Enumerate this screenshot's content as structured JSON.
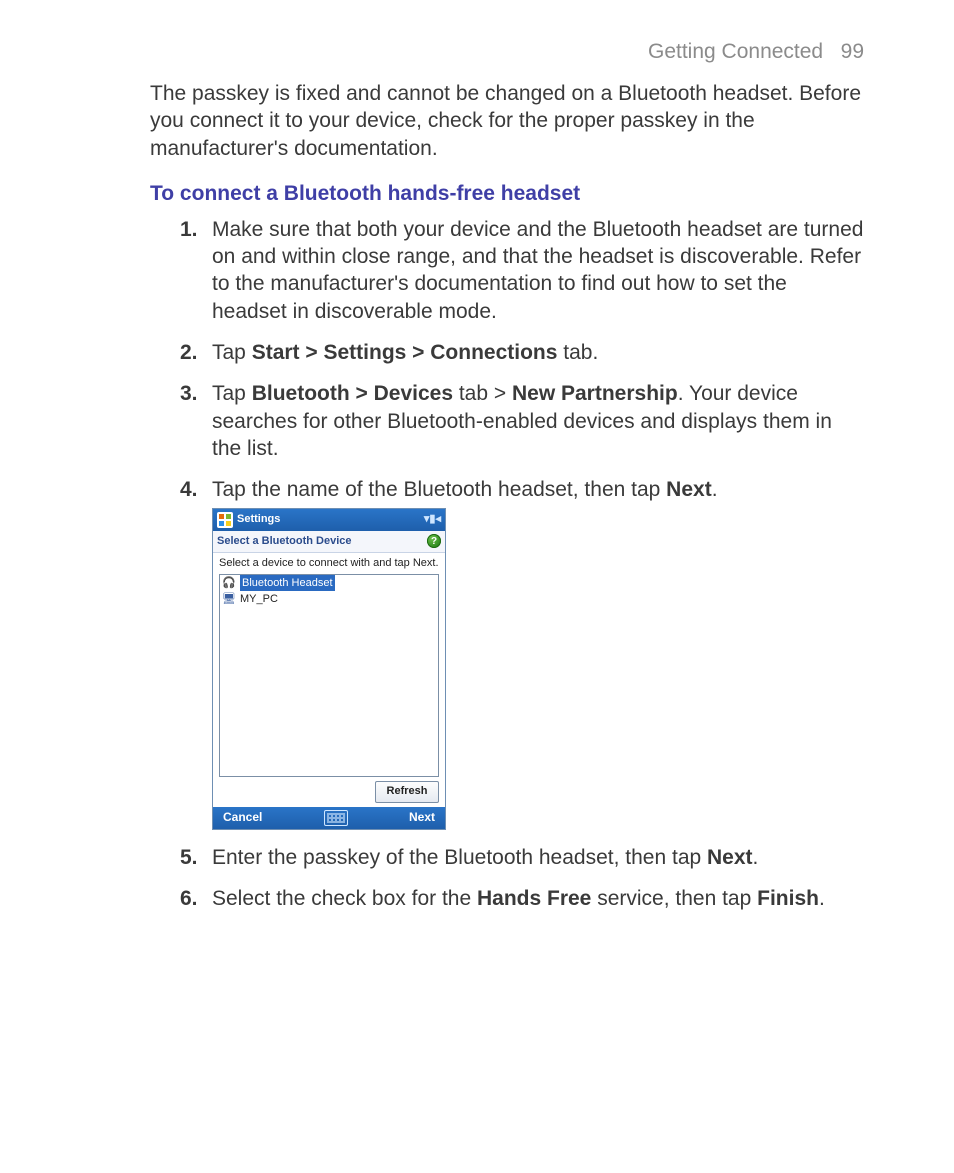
{
  "header": {
    "section": "Getting Connected",
    "page": "99"
  },
  "intro": "The passkey is fixed and cannot be changed on a Bluetooth headset. Before you connect it to your device, check for the proper passkey in the manufacturer's documentation.",
  "section_title": "To connect a Bluetooth hands-free headset",
  "steps": {
    "s1": {
      "num": "1.",
      "text": "Make sure that both your device and the Bluetooth headset are turned on and within close range, and that the headset is discoverable. Refer to the manufacturer's documentation to find out how to set the headset in discoverable mode."
    },
    "s2": {
      "num": "2.",
      "pre": "Tap ",
      "bold": "Start > Settings > Connections",
      "post": " tab."
    },
    "s3": {
      "num": "3.",
      "pre": "Tap ",
      "bold1": "Bluetooth > Devices",
      "mid": " tab > ",
      "bold2": "New Partnership",
      "post": ". Your device searches for other Bluetooth-enabled devices and displays them in the list."
    },
    "s4": {
      "num": "4.",
      "pre": "Tap the name of the Bluetooth headset, then tap ",
      "bold": "Next",
      "post": "."
    },
    "s5": {
      "num": "5.",
      "pre": "Enter the passkey of the Bluetooth headset, then tap ",
      "bold": "Next",
      "post": "."
    },
    "s6": {
      "num": "6.",
      "pre": "Select the check box for the ",
      "bold1": "Hands Free",
      "mid": " service, then tap ",
      "bold2": "Finish",
      "post": "."
    }
  },
  "device": {
    "title": "Settings",
    "signal_icon": "▾▮◂",
    "subbar_title": "Select a Bluetooth Device",
    "help_glyph": "?",
    "instruction": "Select a device to connect with and tap Next.",
    "items": [
      {
        "icon": "🎧",
        "label": "Bluetooth Headset",
        "selected": true
      },
      {
        "icon": "🖥",
        "label": "MY_PC",
        "selected": false
      }
    ],
    "refresh": "Refresh",
    "cancel": "Cancel",
    "next": "Next"
  }
}
